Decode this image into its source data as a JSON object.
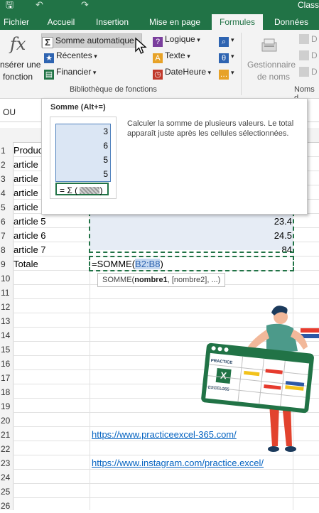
{
  "titlebar": {
    "app_title": "Class"
  },
  "tabs": [
    {
      "label": "Fichier"
    },
    {
      "label": "Accueil"
    },
    {
      "label": "Insertion"
    },
    {
      "label": "Mise en page"
    },
    {
      "label": "Formules"
    },
    {
      "label": "Données"
    }
  ],
  "ribbon": {
    "insert_function": {
      "glyph": "fx",
      "line1": "nsérer une",
      "line2": "fonction"
    },
    "autosum": "Somme automatique",
    "recent": "Récentes",
    "financial": "Financier",
    "logical": "Logique",
    "text": "Texte",
    "datetime": "DateHeure",
    "name_manager": {
      "line1": "Gestionnaire",
      "line2": "de noms"
    },
    "library_label": "Bibliothèque de fonctions",
    "names_label": "Noms d",
    "right_letters": [
      "D",
      "D",
      "D"
    ]
  },
  "namebox": "OU",
  "rows": [
    "1",
    "2",
    "3",
    "4",
    "5",
    "6",
    "7",
    "8",
    "9",
    "10",
    "11",
    "12",
    "13",
    "14",
    "15",
    "16",
    "17",
    "18",
    "19",
    "20",
    "21",
    "22",
    "23",
    "24",
    "25",
    "26"
  ],
  "cells": {
    "a1": "Produc",
    "a2": "article",
    "a3": "article",
    "a4": "article",
    "a5": "article",
    "a6": "article 5",
    "a7": "article 6",
    "a8": "article 7",
    "a9": "Totale",
    "b6": "23.4",
    "b7": "24.5",
    "b8": "84"
  },
  "formula": {
    "prefix": "=SOMME(",
    "ref": "B2:B8",
    "suffix": ")"
  },
  "hint": {
    "name": "SOMME(",
    "arg1": "nombre1",
    "rest": ", [nombre2], ...)"
  },
  "links": {
    "site": "https://www.practiceexcel-365.com/",
    "instagram": "https://www.instagram.com/practice.excel/"
  },
  "tooltip": {
    "title": "Somme (Alt+=)",
    "description": "Calculer la somme de plusieurs valeurs. Le total apparaît juste après les cellules sélectionnées.",
    "example_values": [
      "3",
      "6",
      "5",
      "5"
    ],
    "example_formula": "= Σ (",
    "example_close": ")"
  },
  "illustration": {
    "line1": "PRACTICE",
    "line2": "EXCEL365",
    "logo_letter": "X"
  },
  "colors": {
    "excel_green": "#217346",
    "link_blue": "#0563c1",
    "selection": "#e6ecf5"
  }
}
